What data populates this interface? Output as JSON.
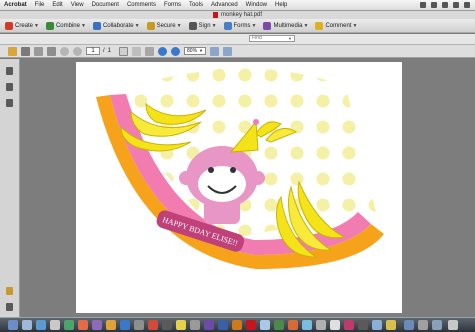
{
  "menubar": {
    "app": "Acrobat",
    "items": [
      "File",
      "Edit",
      "View",
      "Document",
      "Comments",
      "Forms",
      "Tools",
      "Advanced",
      "Window",
      "Help"
    ]
  },
  "window": {
    "title": "monkey hat.pdf"
  },
  "tasks": [
    {
      "label": "Create",
      "color": "#d23a2a"
    },
    {
      "label": "Combine",
      "color": "#3a8a3a"
    },
    {
      "label": "Collaborate",
      "color": "#3a6fc2"
    },
    {
      "label": "Secure",
      "color": "#c79a24"
    },
    {
      "label": "Sign",
      "color": "#555555"
    },
    {
      "label": "Forms",
      "color": "#4a7fc1"
    },
    {
      "label": "Multimedia",
      "color": "#7a4aa8"
    },
    {
      "label": "Comment",
      "color": "#e0b020"
    }
  ],
  "find": {
    "placeholder": "Find"
  },
  "nav": {
    "page_current": "1",
    "page_sep": "/",
    "page_total": "1",
    "zoom": "80%"
  },
  "artwork": {
    "banner_text": "HAPPY BDAY ELISE!!"
  },
  "colors": {
    "pink": "#f27bb0",
    "orange": "#f7a21b",
    "yellow": "#f5e31a",
    "dots": "#f4f0a6",
    "monkey": "#e896c6"
  }
}
